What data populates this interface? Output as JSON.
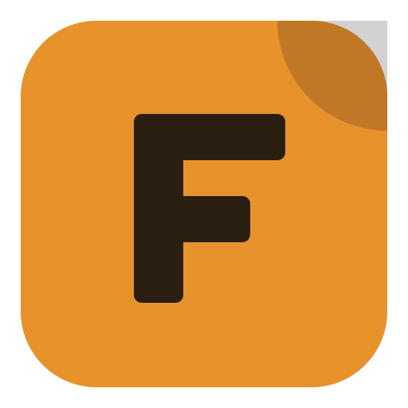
{
  "icon": {
    "name": "app-icon-letter-f",
    "letter": "F",
    "colors": {
      "background": "#ffffff",
      "tile": "#e8922c",
      "corner_fold": "#c07826",
      "corner_paper": "#d2d2d2",
      "letter": "#2a1e10"
    }
  }
}
